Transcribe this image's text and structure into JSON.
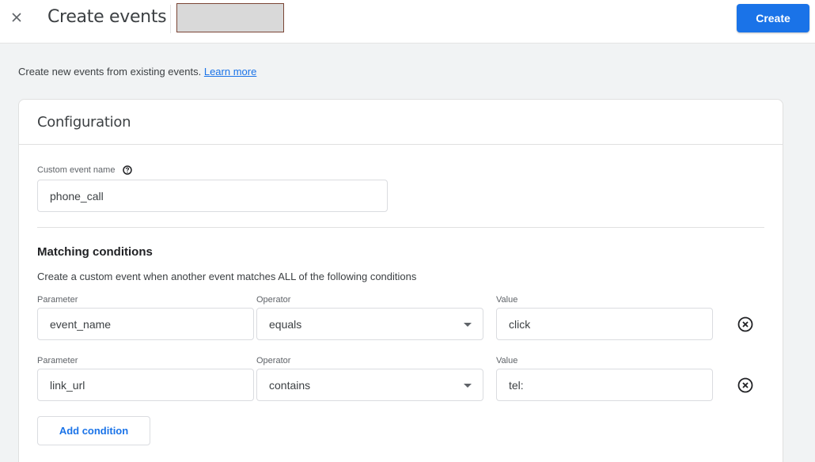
{
  "header": {
    "title": "Create events",
    "create_label": "Create"
  },
  "intro": {
    "text": "Create new events from existing events. ",
    "link": "Learn more"
  },
  "card": {
    "title": "Configuration",
    "custom_event_name_label": "Custom event name",
    "custom_event_name_value": "phone_call",
    "matching_title": "Matching conditions",
    "matching_desc": "Create a custom event when another event matches ALL of the following conditions",
    "conditions": [
      {
        "parameter_label": "Parameter",
        "parameter_value": "event_name",
        "operator_label": "Operator",
        "operator_value": "equals",
        "value_label": "Value",
        "value_value": "click"
      },
      {
        "parameter_label": "Parameter",
        "parameter_value": "link_url",
        "operator_label": "Operator",
        "operator_value": "contains",
        "value_label": "Value",
        "value_value": "tel:"
      }
    ],
    "add_condition_label": "Add condition"
  },
  "colors": {
    "accent": "#1a73e8",
    "background": "#f1f3f4"
  }
}
